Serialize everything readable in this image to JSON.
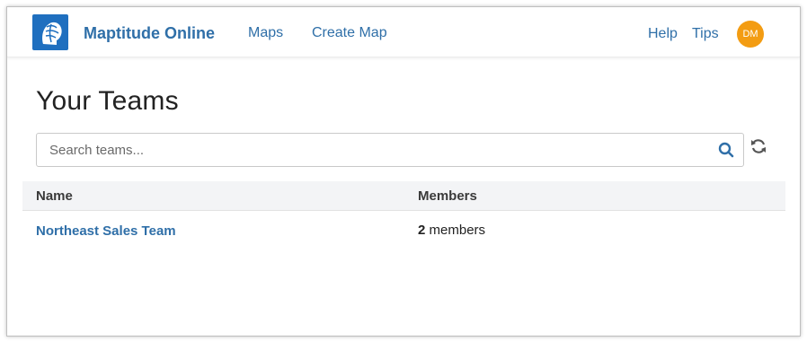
{
  "navbar": {
    "brand": "Maptitude Online",
    "links": [
      {
        "label": "Maps"
      },
      {
        "label": "Create Map"
      }
    ],
    "help_label": "Help",
    "tips_label": "Tips",
    "avatar_initials": "DM",
    "colors": {
      "link": "#2f6fa8",
      "logo_bg": "#1f6fbf",
      "avatar_bg": "#f39c12"
    }
  },
  "main": {
    "title": "Your Teams",
    "search": {
      "placeholder": "Search teams...",
      "value": ""
    },
    "table": {
      "columns": [
        "Name",
        "Members"
      ],
      "rows": [
        {
          "name": "Northeast Sales Team",
          "member_count": "2",
          "member_suffix": "members"
        }
      ]
    }
  },
  "icons": {
    "logo": "maptitude-logo-icon",
    "search": "search-icon",
    "refresh": "refresh-icon"
  }
}
